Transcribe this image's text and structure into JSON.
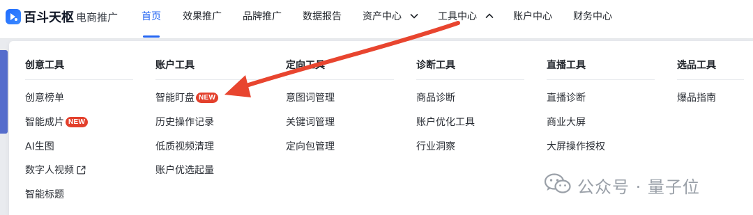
{
  "brand": {
    "name": "百斗天枢",
    "subtitle": "电商推广",
    "accent": "#2566f2"
  },
  "nav": {
    "items": [
      {
        "label": "首页",
        "active": true
      },
      {
        "label": "效果推广"
      },
      {
        "label": "品牌推广"
      },
      {
        "label": "数据报告"
      },
      {
        "label": "资产中心",
        "chevron": "chevron-down-icon"
      },
      {
        "label": "工具中心",
        "chevron": "chevron-up-icon"
      },
      {
        "label": "账户中心"
      },
      {
        "label": "财务中心"
      }
    ]
  },
  "dropdown": {
    "badge_text": "NEW",
    "badge_color": "#e3402c",
    "columns": [
      {
        "title": "创意工具",
        "items": [
          "创意榜单",
          "智能成片",
          "AI生图",
          "数字人视频",
          "智能标题"
        ]
      },
      {
        "title": "账户工具",
        "items": [
          "智能盯盘",
          "历史操作记录",
          "低质视频清理",
          "账户优选起量"
        ]
      },
      {
        "title": "定向工具",
        "items": [
          "意图词管理",
          "关键词管理",
          "定向包管理"
        ]
      },
      {
        "title": "诊断工具",
        "items": [
          "商品诊断",
          "账户优化工具",
          "行业洞察"
        ]
      },
      {
        "title": "直播工具",
        "items": [
          "直播诊断",
          "商业大屏",
          "大屏操作授权"
        ]
      },
      {
        "title": "选品工具",
        "items": [
          "爆品指南"
        ]
      }
    ]
  },
  "annotation": {
    "arrow_color": "#e8452f"
  },
  "watermark": {
    "icon": "wechat-icon",
    "text": "公众号 · 量子位"
  }
}
